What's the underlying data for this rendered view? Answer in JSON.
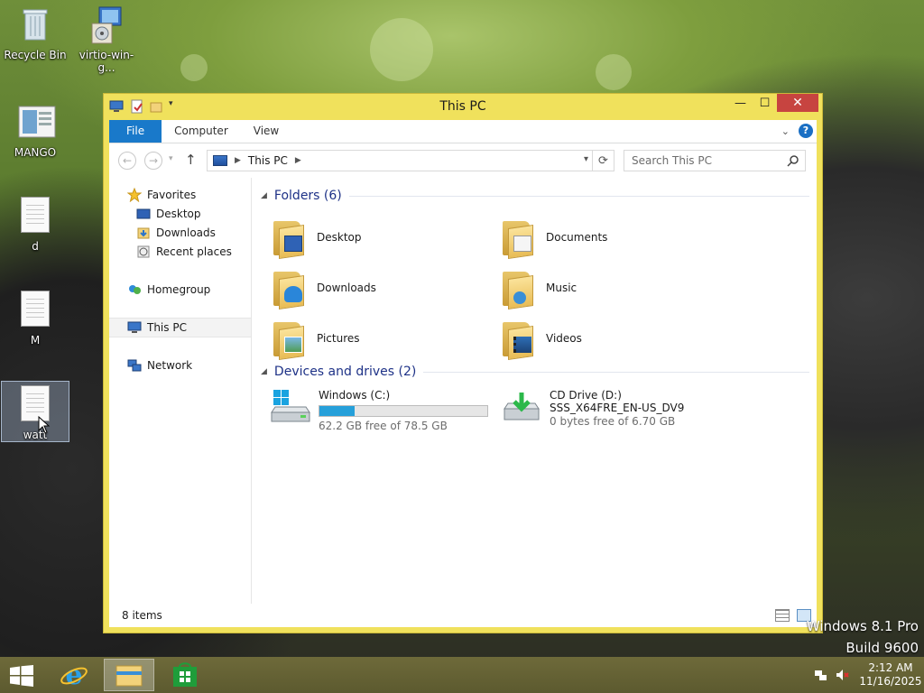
{
  "desktop": {
    "icons": [
      {
        "label": "Recycle Bin"
      },
      {
        "label": "virtio-win-g..."
      },
      {
        "label": "MANGO"
      },
      {
        "label": "d"
      },
      {
        "label": "M"
      },
      {
        "label": "watt"
      }
    ],
    "watermark": {
      "line1": "Windows 8.1 Pro",
      "line2": "Build 9600"
    }
  },
  "window": {
    "title": "This PC",
    "ribbon_tabs": [
      "File",
      "Computer",
      "View"
    ],
    "address": {
      "crumb": "This PC"
    },
    "search": {
      "placeholder": "Search This PC"
    },
    "nav": {
      "favorites": "Favorites",
      "desktop": "Desktop",
      "downloads": "Downloads",
      "recent": "Recent places",
      "homegroup": "Homegroup",
      "thispc": "This PC",
      "network": "Network"
    },
    "folders_header": "Folders (6)",
    "folders": [
      "Desktop",
      "Documents",
      "Downloads",
      "Music",
      "Pictures",
      "Videos"
    ],
    "drives_header": "Devices and drives (2)",
    "drives": [
      {
        "name": "Windows (C:)",
        "free": "62.2 GB free of 78.5 GB",
        "used_fraction": 0.21
      },
      {
        "name": "CD Drive (D:)",
        "label": "SSS_X64FRE_EN-US_DV9",
        "free": "0 bytes free of 6.70 GB"
      }
    ],
    "status": "8 items"
  },
  "taskbar": {
    "time": "2:12 AM",
    "date": "11/16/2025"
  },
  "colors": {
    "window_frame": "#f0e15c",
    "close_button": "#c74440",
    "file_tab": "#1979ca",
    "group_header": "#1e3287",
    "drive_bar": "#26a0da"
  }
}
